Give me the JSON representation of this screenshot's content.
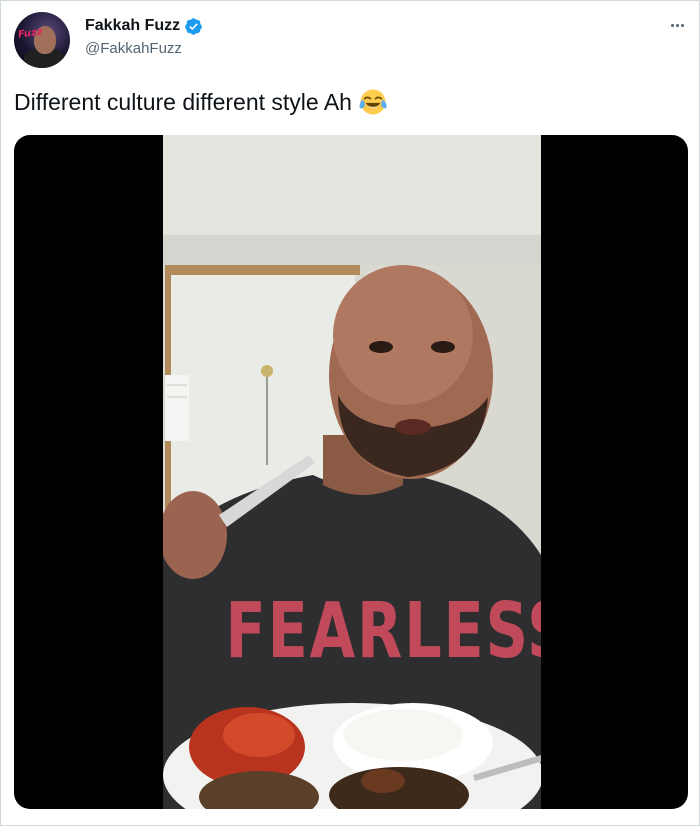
{
  "tweet": {
    "author": {
      "display_name": "Fakkah Fuzz",
      "handle": "@FakkahFuzz",
      "verified": true,
      "avatar_logo_text": "Fuzz"
    },
    "text": "Different culture different style Ah",
    "emoji": "face-with-tears-of-joy",
    "media": {
      "type": "video",
      "shirt_text": "FEARLESS"
    }
  },
  "colors": {
    "text_primary": "#0f1419",
    "text_secondary": "#536471",
    "verified_blue": "#1d9bf0",
    "border": "#cfd9de"
  }
}
